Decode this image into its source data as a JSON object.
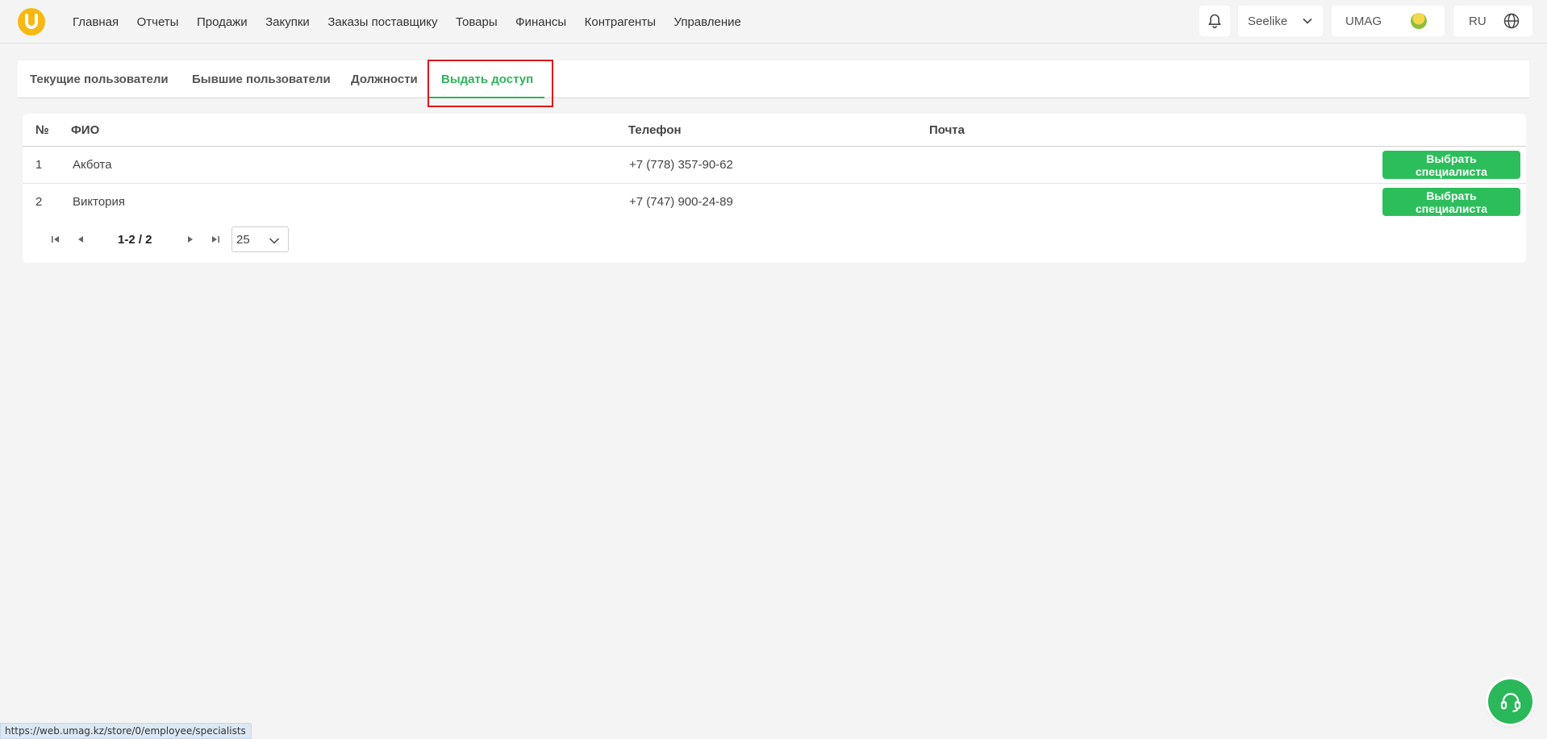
{
  "nav": {
    "items": [
      {
        "label": "Главная"
      },
      {
        "label": "Отчеты"
      },
      {
        "label": "Продажи"
      },
      {
        "label": "Закупки"
      },
      {
        "label": "Заказы поставщику"
      },
      {
        "label": "Товары"
      },
      {
        "label": "Финансы"
      },
      {
        "label": "Контрагенты"
      },
      {
        "label": "Управление"
      }
    ]
  },
  "topright": {
    "company": "Seelike",
    "user": "UMAG",
    "language": "RU"
  },
  "tabs": [
    {
      "label": "Текущие пользователи"
    },
    {
      "label": "Бывшие пользователи"
    },
    {
      "label": "Должности"
    },
    {
      "label": "Выдать доступ",
      "active": true
    }
  ],
  "table": {
    "headers": {
      "num": "№",
      "name": "ФИО",
      "phone": "Телефон",
      "email": "Почта"
    },
    "rows": [
      {
        "num": "1",
        "name": "Акбота",
        "phone": "+7 (778) 357-90-62",
        "email": "",
        "action": "Выбрать специалиста"
      },
      {
        "num": "2",
        "name": "Виктория",
        "phone": "+7 (747) 900-24-89",
        "email": "",
        "action": "Выбрать специалиста"
      }
    ]
  },
  "pager": {
    "info": "1-2 / 2",
    "page_size": "25"
  },
  "status_url": "https://web.umag.kz/store/0/employee/specialists",
  "colors": {
    "accent": "#2eb55a",
    "logo": "#f7b813",
    "highlight": "#e0181c"
  }
}
